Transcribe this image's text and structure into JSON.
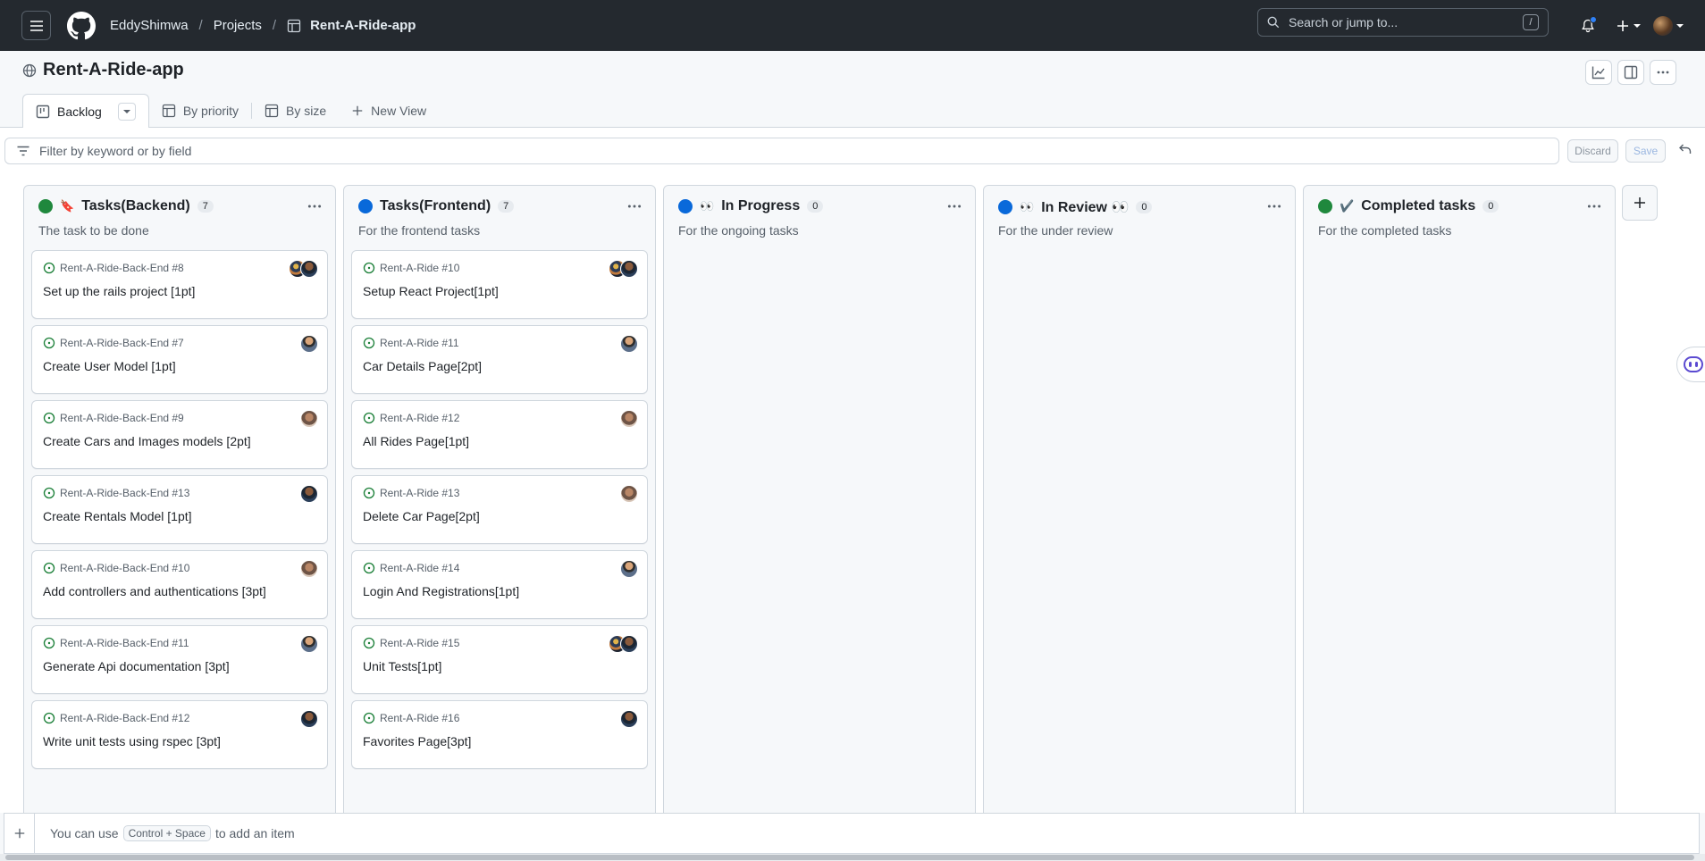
{
  "header": {
    "owner": "EddyShimwa",
    "projects_link": "Projects",
    "project_name": "Rent-A-Ride-app",
    "search_placeholder": "Search or jump to...",
    "search_shortcut": "/"
  },
  "project": {
    "title": "Rent-A-Ride-app",
    "views": [
      {
        "label": "Backlog",
        "icon": "board-icon",
        "active": true
      },
      {
        "label": "By priority",
        "icon": "table-icon"
      },
      {
        "label": "By size",
        "icon": "table-icon"
      },
      {
        "label": "New View",
        "icon": "plus-icon"
      }
    ]
  },
  "filter": {
    "placeholder": "Filter by keyword or by field",
    "discard_label": "Discard",
    "save_label": "Save"
  },
  "columns": [
    {
      "name": "Tasks(Backend)",
      "emoji": "🔖",
      "count": "7",
      "dot_color": "#1f883d",
      "description": "The task to be done",
      "cards": [
        {
          "repo": "Rent-A-Ride-Back-End #8",
          "title": "Set up the rails project [1pt]",
          "avatars": [
            "av-d",
            "av-b"
          ]
        },
        {
          "repo": "Rent-A-Ride-Back-End #7",
          "title": "Create User Model [1pt]",
          "avatars": [
            "av-a"
          ]
        },
        {
          "repo": "Rent-A-Ride-Back-End #9",
          "title": "Create Cars and Images models [2pt]",
          "avatars": [
            "av-c"
          ]
        },
        {
          "repo": "Rent-A-Ride-Back-End #13",
          "title": "Create Rentals Model [1pt]",
          "avatars": [
            "av-b"
          ]
        },
        {
          "repo": "Rent-A-Ride-Back-End #10",
          "title": "Add controllers and authentications [3pt]",
          "avatars": [
            "av-c"
          ]
        },
        {
          "repo": "Rent-A-Ride-Back-End #11",
          "title": "Generate Api documentation [3pt]",
          "avatars": [
            "av-a"
          ]
        },
        {
          "repo": "Rent-A-Ride-Back-End #12",
          "title": "Write unit tests using rspec [3pt]",
          "avatars": [
            "av-b"
          ]
        }
      ]
    },
    {
      "name": "Tasks(Frontend)",
      "emoji": "",
      "count": "7",
      "dot_color": "#0969da",
      "description": "For the frontend tasks",
      "cards": [
        {
          "repo": "Rent-A-Ride #10",
          "title": "Setup React Project[1pt]",
          "avatars": [
            "av-d",
            "av-b"
          ]
        },
        {
          "repo": "Rent-A-Ride #11",
          "title": "Car Details Page[2pt]",
          "avatars": [
            "av-a"
          ]
        },
        {
          "repo": "Rent-A-Ride #12",
          "title": "All Rides Page[1pt]",
          "avatars": [
            "av-c"
          ]
        },
        {
          "repo": "Rent-A-Ride #13",
          "title": "Delete Car Page[2pt]",
          "avatars": [
            "av-c"
          ]
        },
        {
          "repo": "Rent-A-Ride #14",
          "title": "Login And Registrations[1pt]",
          "avatars": [
            "av-a"
          ]
        },
        {
          "repo": "Rent-A-Ride #15",
          "title": "Unit Tests[1pt]",
          "avatars": [
            "av-d",
            "av-b"
          ]
        },
        {
          "repo": "Rent-A-Ride #16",
          "title": "Favorites Page[3pt]",
          "avatars": [
            "av-b"
          ]
        }
      ]
    },
    {
      "name": "In Progress",
      "emoji": "👀",
      "count": "0",
      "dot_color": "#0969da",
      "description": "For the ongoing tasks",
      "cards": []
    },
    {
      "name": "In Review 👀",
      "emoji": "👀",
      "count": "0",
      "dot_color": "#0969da",
      "description": "For the under review",
      "cards": []
    },
    {
      "name": "Completed tasks",
      "emoji": "✔️",
      "count": "0",
      "dot_color": "#1f883d",
      "description": "For the completed tasks",
      "cards": []
    }
  ],
  "add_item": {
    "prefix": "You can use",
    "shortcut": "Control + Space",
    "suffix": "to add an item"
  }
}
